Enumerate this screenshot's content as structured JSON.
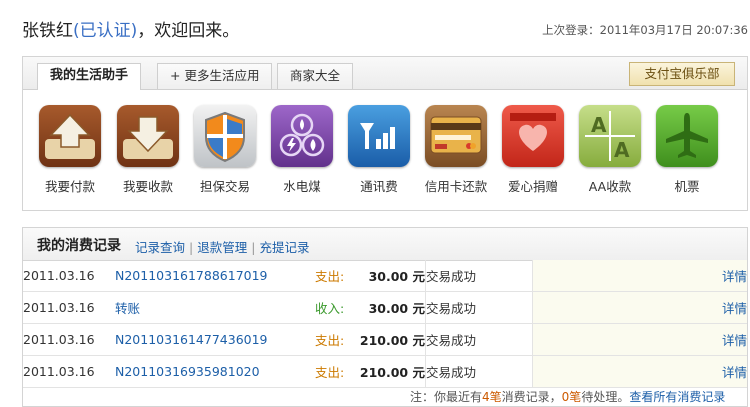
{
  "header": {
    "user_name": "张铁红",
    "verified_label": "(已认证)",
    "welcome_suffix": "，欢迎回来。",
    "last_login": "上次登录：2011年03月17日 20:07:36"
  },
  "assistant": {
    "tabs": [
      "我的生活助手",
      "+ 更多生活应用",
      "商家大全"
    ],
    "club_button": "支付宝俱乐部",
    "apps": [
      {
        "icon": "upload-arrow-icon",
        "label": "我要付款"
      },
      {
        "icon": "download-arrow-icon",
        "label": "我要收款"
      },
      {
        "icon": "shield-icon",
        "label": "担保交易"
      },
      {
        "icon": "utility-icon",
        "label": "水电煤"
      },
      {
        "icon": "signal-icon",
        "label": "通讯费"
      },
      {
        "icon": "credit-card-icon",
        "label": "信用卡还款"
      },
      {
        "icon": "heart-icon",
        "label": "爱心捐赠"
      },
      {
        "icon": "aa-icon",
        "label": "AA收款"
      },
      {
        "icon": "airplane-icon",
        "label": "机票"
      }
    ]
  },
  "records": {
    "title": "我的消费记录",
    "links": [
      "记录查询",
      "退款管理",
      "充提记录"
    ],
    "rows": [
      {
        "date": "2011.03.16",
        "number": "N201103161788617019",
        "direction": "支出:",
        "dir_type": "out",
        "amount": "30.00",
        "unit": "元",
        "status": "交易成功",
        "detail": "详情"
      },
      {
        "date": "2011.03.16",
        "number": "转账",
        "direction": "收入:",
        "dir_type": "in",
        "amount": "30.00",
        "unit": "元",
        "status": "交易成功",
        "detail": "详情"
      },
      {
        "date": "2011.03.16",
        "number": "N201103161477436019",
        "direction": "支出:",
        "dir_type": "out",
        "amount": "210.00",
        "unit": "元",
        "status": "交易成功",
        "detail": "详情"
      },
      {
        "date": "2011.03.16",
        "number": "N20110316935981020",
        "direction": "支出:",
        "dir_type": "out",
        "amount": "210.00",
        "unit": "元",
        "status": "交易成功",
        "detail": "详情"
      }
    ],
    "footer": {
      "prefix": "注：你最近有",
      "count1": "4笔",
      "middle": "消费记录，",
      "count2": "0笔",
      "suffix": "待处理。",
      "link": "查看所有消费记录"
    }
  },
  "colors": {
    "out": "#cc7a00",
    "in": "#3c9a2e",
    "link": "#1d5fa8"
  }
}
